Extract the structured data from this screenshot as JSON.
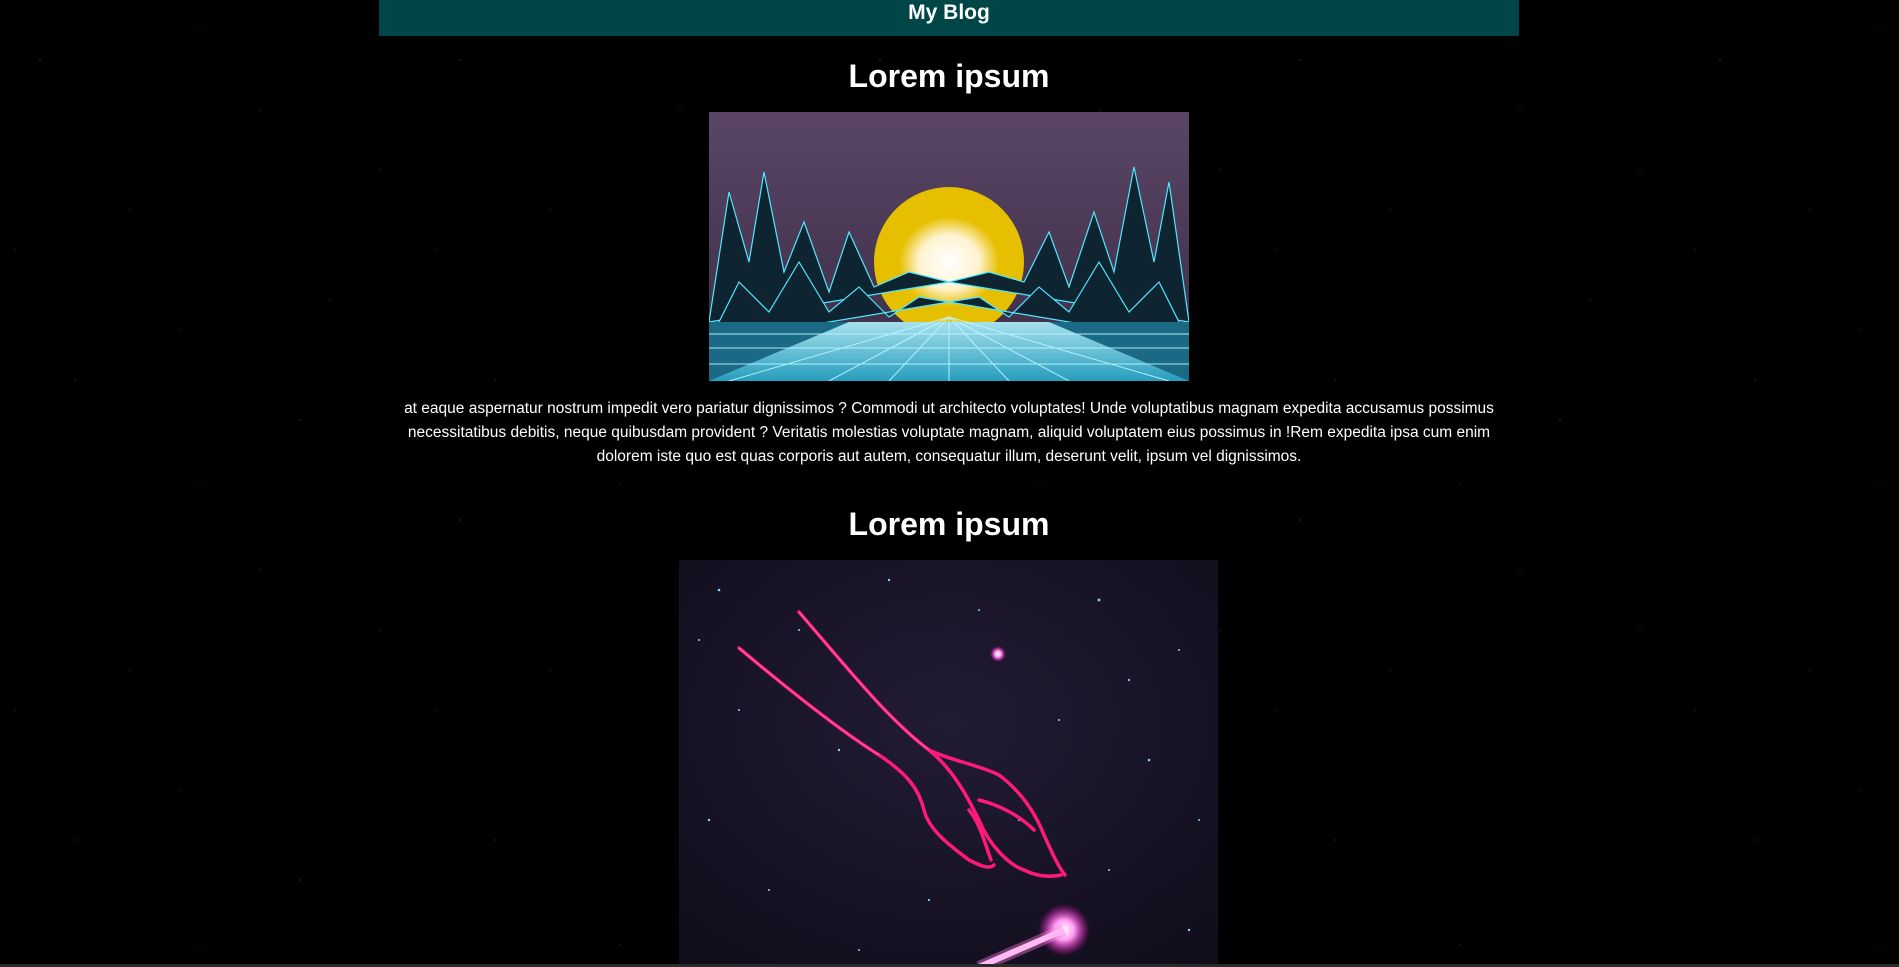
{
  "header": {
    "title": "My Blog"
  },
  "posts": [
    {
      "title": "Lorem ipsum",
      "image": "synthwave-mountains-image",
      "text": "at eaque aspernatur nostrum impedit vero pariatur dignissimos ? Commodi ut architecto voluptates! Unde voluptatibus magnam expedita accusamus possimus necessitatibus debitis, neque quibusdam provident ? Veritatis molestias voluptate magnam, aliquid voluptatem eius possimus in !Rem expedita ipsa cum enim dolorem iste quo est quas corporis aut autem, consequatur illum, deserunt velit, ipsum vel dignissimos."
    },
    {
      "title": "Lorem ipsum",
      "image": "neon-hand-space-image"
    }
  ],
  "colors": {
    "background": "#000000",
    "header": "#004548",
    "neon_pink": "#ff1a7a",
    "neon_cyan": "#4fe8ff",
    "sun_yellow": "#e6c000"
  }
}
